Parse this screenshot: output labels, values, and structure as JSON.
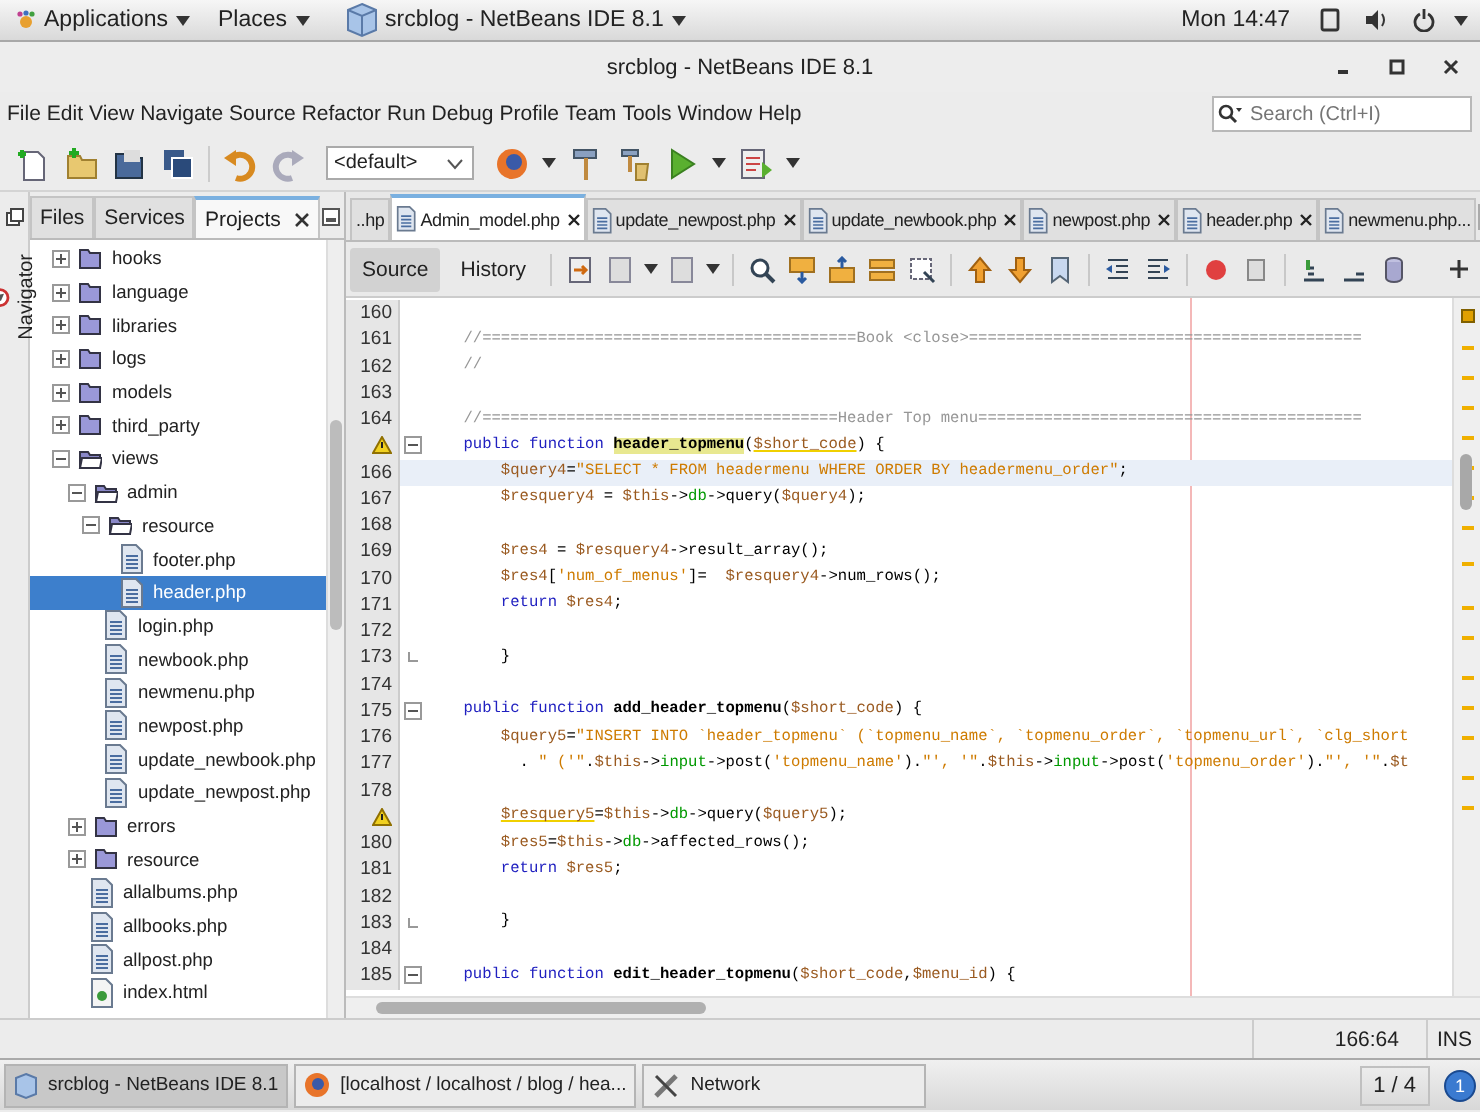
{
  "top_panel": {
    "applications": "Applications",
    "places": "Places",
    "window_button": "srcblog - NetBeans IDE 8.1",
    "clock": "Mon 14:47"
  },
  "window": {
    "title": "srcblog - NetBeans IDE 8.1"
  },
  "menu": [
    "File",
    "Edit",
    "View",
    "Navigate",
    "Source",
    "Refactor",
    "Run",
    "Debug",
    "Profile",
    "Team",
    "Tools",
    "Window",
    "Help"
  ],
  "search": {
    "placeholder": "Search (Ctrl+I)"
  },
  "toolbar": {
    "configuration": "<default>"
  },
  "navigator": {
    "label": "Navigator"
  },
  "side_tabs": [
    {
      "label": "Files",
      "selected": false
    },
    {
      "label": "Services",
      "selected": false
    },
    {
      "label": "Projects",
      "selected": true
    }
  ],
  "tree": [
    {
      "label": "hooks",
      "kind": "folder",
      "expanded": false,
      "selected": false
    },
    {
      "label": "language",
      "kind": "folder",
      "expanded": false,
      "selected": false
    },
    {
      "label": "libraries",
      "kind": "folder",
      "expanded": false,
      "selected": false
    },
    {
      "label": "logs",
      "kind": "folder",
      "expanded": false,
      "selected": false
    },
    {
      "label": "models",
      "kind": "folder",
      "expanded": false,
      "selected": false
    },
    {
      "label": "third_party",
      "kind": "folder",
      "expanded": false,
      "selected": false
    },
    {
      "label": "views",
      "kind": "folder",
      "expanded": true,
      "selected": false,
      "children": [
        {
          "label": "admin",
          "kind": "folder",
          "expanded": true,
          "selected": false,
          "children": [
            {
              "label": "resource",
              "kind": "folder",
              "expanded": true,
              "selected": false,
              "children": [
                {
                  "label": "footer.php",
                  "kind": "file",
                  "selected": false
                },
                {
                  "label": "header.php",
                  "kind": "file",
                  "selected": true
                }
              ]
            },
            {
              "label": "login.php",
              "kind": "file",
              "selected": false
            },
            {
              "label": "newbook.php",
              "kind": "file",
              "selected": false
            },
            {
              "label": "newmenu.php",
              "kind": "file",
              "selected": false
            },
            {
              "label": "newpost.php",
              "kind": "file",
              "selected": false
            },
            {
              "label": "update_newbook.php",
              "kind": "file",
              "selected": false
            },
            {
              "label": "update_newpost.php",
              "kind": "file",
              "selected": false
            }
          ]
        },
        {
          "label": "errors",
          "kind": "folder",
          "expanded": false,
          "selected": false
        },
        {
          "label": "resource",
          "kind": "folder",
          "expanded": false,
          "selected": false
        },
        {
          "label": "allalbums.php",
          "kind": "file",
          "selected": false
        },
        {
          "label": "allbooks.php",
          "kind": "file",
          "selected": false
        },
        {
          "label": "allpost.php",
          "kind": "file",
          "selected": false
        },
        {
          "label": "index.html",
          "kind": "html",
          "selected": false
        }
      ]
    }
  ],
  "editor_tabs": [
    {
      "label": "..hp",
      "selected": false,
      "closable": false
    },
    {
      "label": "Admin_model.php",
      "selected": true,
      "closable": true
    },
    {
      "label": "update_newpost.php",
      "selected": false,
      "closable": true
    },
    {
      "label": "update_newbook.php",
      "selected": false,
      "closable": true
    },
    {
      "label": "newpost.php",
      "selected": false,
      "closable": true
    },
    {
      "label": "header.php",
      "selected": false,
      "closable": true
    },
    {
      "label": "newmenu.php...",
      "selected": false,
      "closable": false
    }
  ],
  "view_tabs": [
    {
      "label": "Source",
      "selected": true
    },
    {
      "label": "History",
      "selected": false
    }
  ],
  "code": [
    {
      "number": "160",
      "warning": false,
      "fold_start": false,
      "fold_end": false,
      "current": false
    },
    {
      "number": "161",
      "warning": false,
      "fold_start": false,
      "fold_end": false,
      "current": false,
      "tokens": [
        {
          "kind": "comment",
          "text": "    //========================================Book <close>=========================================="
        }
      ]
    },
    {
      "number": "162",
      "warning": false,
      "fold_start": false,
      "fold_end": false,
      "current": false,
      "tokens": [
        {
          "kind": "comment",
          "text": "    //"
        }
      ]
    },
    {
      "number": "163",
      "warning": false,
      "fold_start": false,
      "fold_end": false,
      "current": false
    },
    {
      "number": "164",
      "warning": false,
      "fold_start": false,
      "fold_end": false,
      "current": false,
      "tokens": [
        {
          "kind": "comment",
          "text": "    //======================================Header Top menu========================================="
        }
      ]
    },
    {
      "warning": true,
      "fold_start": true,
      "fold_end": false,
      "current": false,
      "tokens": [
        {
          "kind": "keyword",
          "text": "    public function "
        },
        {
          "kind": "mark",
          "text": "header_topmenu"
        },
        {
          "kind": "plain",
          "text": "("
        },
        {
          "kind": "warn",
          "text": "$short_code"
        },
        {
          "kind": "plain",
          "text": ") {"
        }
      ]
    },
    {
      "number": "166",
      "warning": false,
      "fold_start": false,
      "fold_end": false,
      "current": true,
      "tokens": [
        {
          "kind": "var",
          "text": "        $query4"
        },
        {
          "kind": "plain",
          "text": "="
        },
        {
          "kind": "string",
          "text": "\"SELECT * FROM headermenu WHERE ORDER BY headermenu_order\""
        },
        {
          "kind": "plain",
          "text": ";"
        }
      ]
    },
    {
      "number": "167",
      "warning": false,
      "fold_start": false,
      "fold_end": false,
      "current": false,
      "tokens": [
        {
          "kind": "var",
          "text": "        $resquery4"
        },
        {
          "kind": "plain",
          "text": " = "
        },
        {
          "kind": "var",
          "text": "$this"
        },
        {
          "kind": "plain",
          "text": "->"
        },
        {
          "kind": "prop",
          "text": "db"
        },
        {
          "kind": "plain",
          "text": "->query("
        },
        {
          "kind": "var",
          "text": "$query4"
        },
        {
          "kind": "plain",
          "text": ");"
        }
      ]
    },
    {
      "number": "168",
      "warning": false,
      "fold_start": false,
      "fold_end": false,
      "current": false
    },
    {
      "number": "169",
      "warning": false,
      "fold_start": false,
      "fold_end": false,
      "current": false,
      "tokens": [
        {
          "kind": "var",
          "text": "        $res4"
        },
        {
          "kind": "plain",
          "text": " = "
        },
        {
          "kind": "var",
          "text": "$resquery4"
        },
        {
          "kind": "plain",
          "text": "->result_array();"
        }
      ]
    },
    {
      "number": "170",
      "warning": false,
      "fold_start": false,
      "fold_end": false,
      "current": false,
      "tokens": [
        {
          "kind": "var",
          "text": "        $res4"
        },
        {
          "kind": "plain",
          "text": "["
        },
        {
          "kind": "string",
          "text": "'num_of_menus'"
        },
        {
          "kind": "plain",
          "text": "]=  "
        },
        {
          "kind": "var",
          "text": "$resquery4"
        },
        {
          "kind": "plain",
          "text": "->num_rows();"
        }
      ]
    },
    {
      "number": "171",
      "warning": false,
      "fold_start": false,
      "fold_end": false,
      "current": false,
      "tokens": [
        {
          "kind": "keyword",
          "text": "        return "
        },
        {
          "kind": "var",
          "text": "$res4"
        },
        {
          "kind": "plain",
          "text": ";"
        }
      ]
    },
    {
      "number": "172",
      "warning": false,
      "fold_start": false,
      "fold_end": false,
      "current": false
    },
    {
      "number": "173",
      "warning": false,
      "fold_start": false,
      "fold_end": true,
      "current": false,
      "tokens": [
        {
          "kind": "plain",
          "text": "        }"
        }
      ]
    },
    {
      "number": "174",
      "warning": false,
      "fold_start": false,
      "fold_end": false,
      "current": false
    },
    {
      "number": "175",
      "warning": false,
      "fold_start": true,
      "fold_end": false,
      "current": false,
      "tokens": [
        {
          "kind": "keyword",
          "text": "    public function "
        },
        {
          "kind": "name",
          "text": "add_header_topmenu"
        },
        {
          "kind": "plain",
          "text": "("
        },
        {
          "kind": "var",
          "text": "$short_code"
        },
        {
          "kind": "plain",
          "text": ") {"
        }
      ]
    },
    {
      "number": "176",
      "warning": false,
      "fold_start": false,
      "fold_end": false,
      "current": false,
      "tokens": [
        {
          "kind": "var",
          "text": "        $query5"
        },
        {
          "kind": "plain",
          "text": "="
        },
        {
          "kind": "string",
          "text": "\"INSERT INTO `header_topmenu` (`topmenu_name`, `topmenu_order`, `topmenu_url`, `clg_short"
        }
      ]
    },
    {
      "number": "177",
      "warning": false,
      "fold_start": false,
      "fold_end": false,
      "current": false,
      "tokens": [
        {
          "kind": "plain",
          "text": "          . "
        },
        {
          "kind": "string",
          "text": "\" ('\""
        },
        {
          "kind": "plain",
          "text": "."
        },
        {
          "kind": "var",
          "text": "$this"
        },
        {
          "kind": "plain",
          "text": "->"
        },
        {
          "kind": "prop",
          "text": "input"
        },
        {
          "kind": "plain",
          "text": "->post("
        },
        {
          "kind": "string",
          "text": "'topmenu_name'"
        },
        {
          "kind": "plain",
          "text": ")."
        },
        {
          "kind": "string",
          "text": "\"', '\""
        },
        {
          "kind": "plain",
          "text": "."
        },
        {
          "kind": "var",
          "text": "$this"
        },
        {
          "kind": "plain",
          "text": "->"
        },
        {
          "kind": "prop",
          "text": "input"
        },
        {
          "kind": "plain",
          "text": "->post("
        },
        {
          "kind": "string",
          "text": "'topmenu_order'"
        },
        {
          "kind": "plain",
          "text": ")."
        },
        {
          "kind": "string",
          "text": "\"', '\""
        },
        {
          "kind": "plain",
          "text": "."
        },
        {
          "kind": "var",
          "text": "$t"
        }
      ]
    },
    {
      "number": "178",
      "warning": false,
      "fold_start": false,
      "fold_end": false,
      "current": false
    },
    {
      "warning": true,
      "fold_start": false,
      "fold_end": false,
      "current": false,
      "tokens": [
        {
          "kind": "warn",
          "text": "        $resquery5"
        },
        {
          "kind": "plain",
          "text": "="
        },
        {
          "kind": "var",
          "text": "$this"
        },
        {
          "kind": "plain",
          "text": "->"
        },
        {
          "kind": "prop",
          "text": "db"
        },
        {
          "kind": "plain",
          "text": "->query("
        },
        {
          "kind": "var",
          "text": "$query5"
        },
        {
          "kind": "plain",
          "text": ");"
        }
      ]
    },
    {
      "number": "180",
      "warning": false,
      "fold_start": false,
      "fold_end": false,
      "current": false,
      "tokens": [
        {
          "kind": "var",
          "text": "        $res5"
        },
        {
          "kind": "plain",
          "text": "="
        },
        {
          "kind": "var",
          "text": "$this"
        },
        {
          "kind": "plain",
          "text": "->"
        },
        {
          "kind": "prop",
          "text": "db"
        },
        {
          "kind": "plain",
          "text": "->affected_rows();"
        }
      ]
    },
    {
      "number": "181",
      "warning": false,
      "fold_start": false,
      "fold_end": false,
      "current": false,
      "tokens": [
        {
          "kind": "keyword",
          "text": "        return "
        },
        {
          "kind": "var",
          "text": "$res5"
        },
        {
          "kind": "plain",
          "text": ";"
        }
      ]
    },
    {
      "number": "182",
      "warning": false,
      "fold_start": false,
      "fold_end": false,
      "current": false
    },
    {
      "number": "183",
      "warning": false,
      "fold_start": false,
      "fold_end": true,
      "current": false,
      "tokens": [
        {
          "kind": "plain",
          "text": "        }"
        }
      ]
    },
    {
      "number": "184",
      "warning": false,
      "fold_start": false,
      "fold_end": false,
      "current": false
    },
    {
      "number": "185",
      "warning": false,
      "fold_start": true,
      "fold_end": false,
      "current": false,
      "tokens": [
        {
          "kind": "keyword",
          "text": "    public function "
        },
        {
          "kind": "name",
          "text": "edit_header_topmenu"
        },
        {
          "kind": "plain",
          "text": "("
        },
        {
          "kind": "var",
          "text": "$short_code"
        },
        {
          "kind": "plain",
          "text": ","
        },
        {
          "kind": "var",
          "text": "$menu_id"
        },
        {
          "kind": "plain",
          "text": ") {"
        }
      ]
    }
  ],
  "status_bar": {
    "position": "166:64",
    "mode": "INS"
  },
  "taskbar": [
    {
      "label": "srcblog - NetBeans IDE 8.1",
      "kind": "netbeans",
      "selected": true
    },
    {
      "label": "[localhost / localhost / blog / hea...",
      "kind": "browser",
      "selected": false
    },
    {
      "label": "Network",
      "kind": "tools",
      "selected": false
    }
  ],
  "workspace": {
    "pager": "1 / 4",
    "notifications": "1"
  }
}
